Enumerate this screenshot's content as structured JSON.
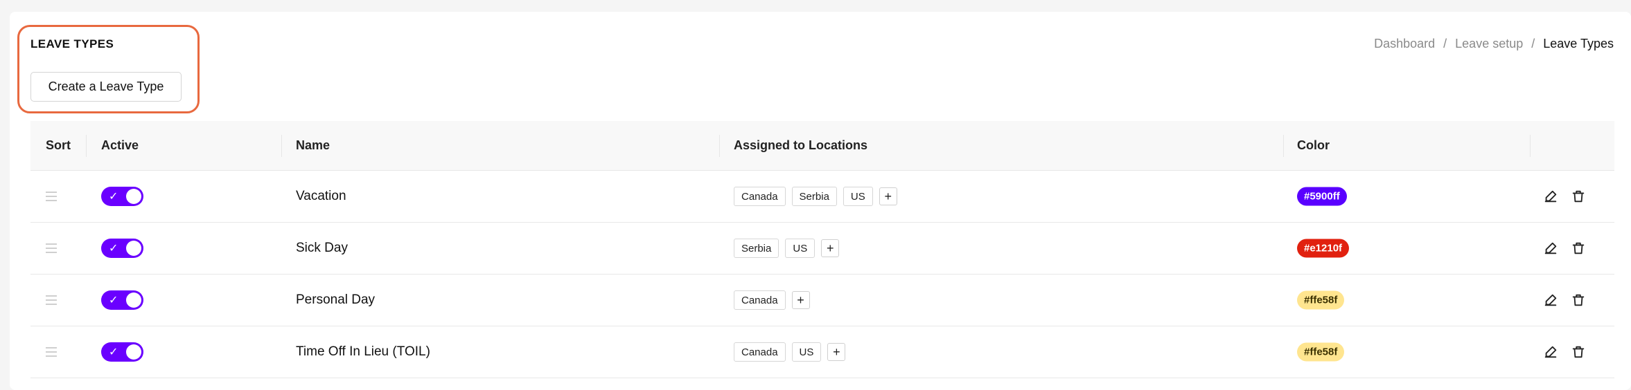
{
  "header": {
    "title": "LEAVE TYPES",
    "create_button": "Create a Leave Type",
    "breadcrumb": [
      "Dashboard",
      "Leave setup",
      "Leave Types"
    ],
    "breadcrumb_separator": "/"
  },
  "table": {
    "columns": [
      "Sort",
      "Active",
      "Name",
      "Assigned to Locations",
      "Color"
    ],
    "rows": [
      {
        "name": "Vacation",
        "active": true,
        "locations": [
          "Canada",
          "Serbia",
          "US"
        ],
        "color": "#5900ff",
        "badge_text_color": "#ffffff"
      },
      {
        "name": "Sick Day",
        "active": true,
        "locations": [
          "Serbia",
          "US"
        ],
        "color": "#e1210f",
        "badge_text_color": "#ffffff"
      },
      {
        "name": "Personal Day",
        "active": true,
        "locations": [
          "Canada"
        ],
        "color": "#ffe58f",
        "badge_text_color": "#3a3000"
      },
      {
        "name": "Time Off In Lieu (TOIL)",
        "active": true,
        "locations": [
          "Canada",
          "US"
        ],
        "color": "#ffe58f",
        "badge_text_color": "#3a3000"
      }
    ],
    "row_icons": {
      "drag": "drag-handle-icon",
      "edit": "edit-icon",
      "delete": "trash-icon",
      "add_location": "plus-icon",
      "toggle_on": "check-icon"
    }
  },
  "colors": {
    "accent": "#6a00ff",
    "highlight_outline": "#e8693f"
  }
}
